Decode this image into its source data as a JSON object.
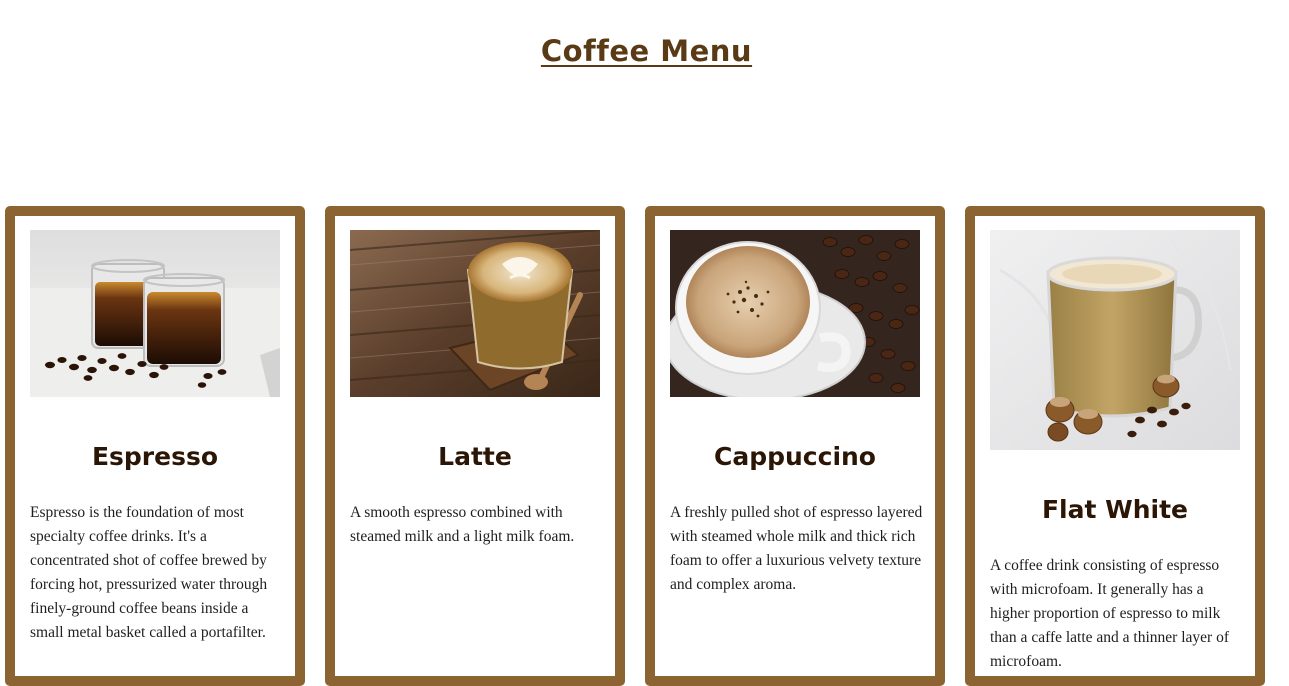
{
  "page": {
    "title": "Coffee Menu"
  },
  "colors": {
    "card_border": "#8b6431",
    "title": "#5a3a14",
    "heading": "#2b1606"
  },
  "menu": [
    {
      "name": "Espresso",
      "image": "espresso-glasses-photo",
      "description": "Espresso is the foundation of most specialty coffee drinks. It's a concentrated shot of coffee brewed by forcing hot, pressurized water through finely-ground coffee beans inside a small metal basket called a portafilter."
    },
    {
      "name": "Latte",
      "image": "latte-art-glass-photo",
      "description": "A smooth espresso combined with steamed milk and a light milk foam."
    },
    {
      "name": "Cappuccino",
      "image": "cappuccino-cup-photo",
      "description": "A freshly pulled shot of espresso layered with steamed whole milk and thick rich foam to offer a luxurious velvety texture and complex aroma."
    },
    {
      "name": "Flat White",
      "image": "flat-white-mug-photo",
      "description": "A coffee drink consisting of espresso with microfoam. It generally has a higher proportion of espresso to milk than a caffe latte and a thinner layer of microfoam."
    }
  ]
}
